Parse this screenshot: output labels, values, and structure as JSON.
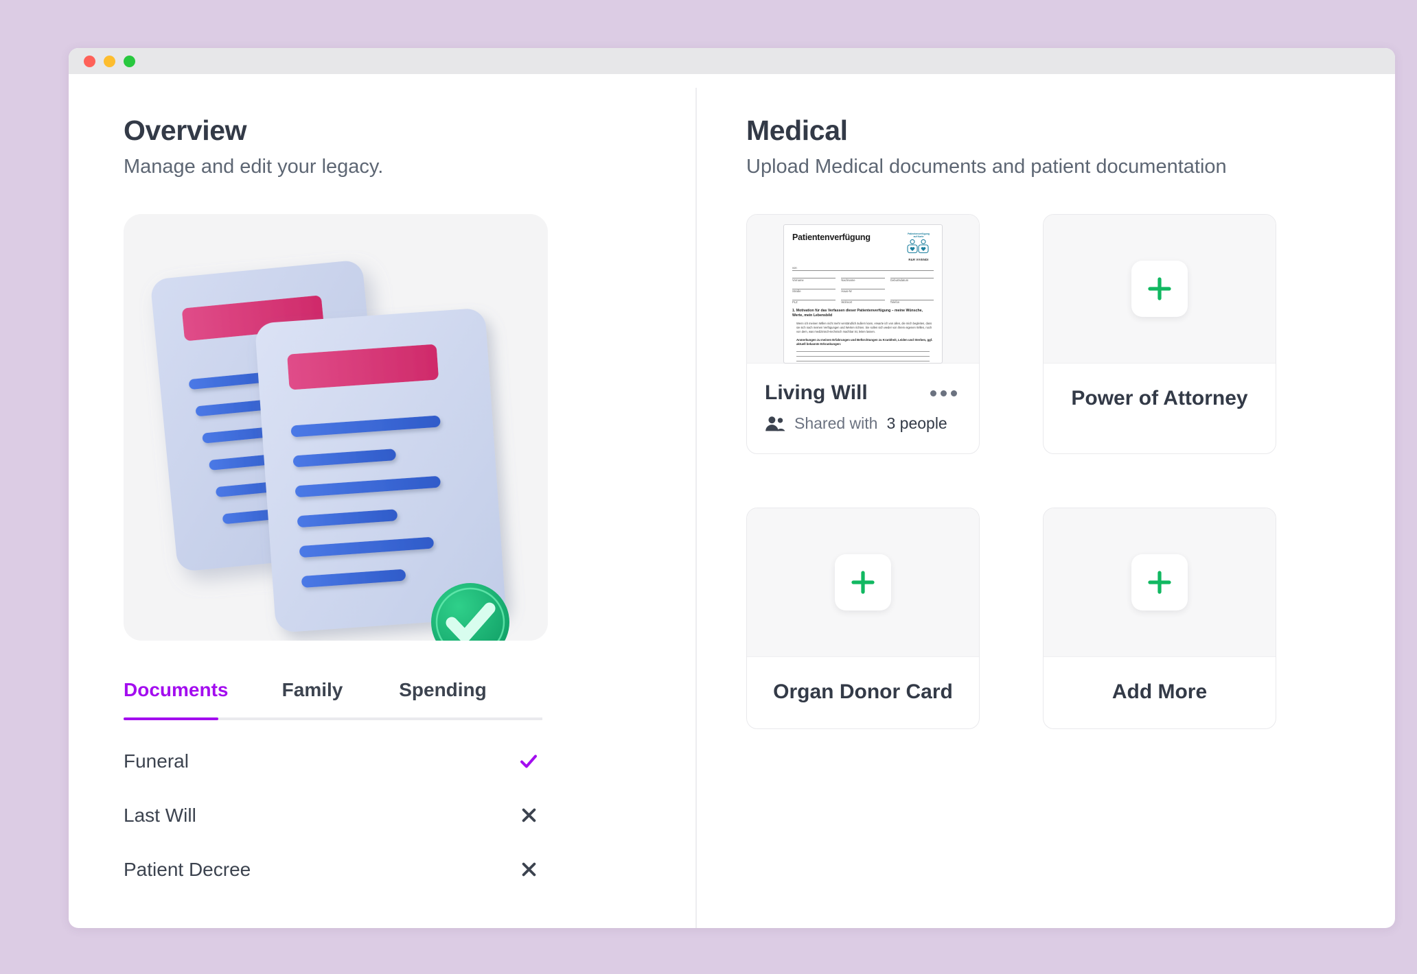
{
  "window": {
    "traffic_lights": [
      "close",
      "minimize",
      "maximize"
    ]
  },
  "left": {
    "title": "Overview",
    "subtitle": "Manage and edit your legacy.",
    "illustration": {
      "name": "documents-3d-illustration",
      "colors": {
        "paper": "#ccd6ee",
        "accent_bar": "#db3a77",
        "text_line": "#3d68d8",
        "check_badge": "#11a86a"
      }
    },
    "tabs": [
      {
        "label": "Documents",
        "active": true
      },
      {
        "label": "Family",
        "active": false
      },
      {
        "label": "Spending",
        "active": false
      }
    ],
    "documents": [
      {
        "label": "Funeral",
        "state": "check"
      },
      {
        "label": "Last Will",
        "state": "cross"
      },
      {
        "label": "Patient Decree",
        "state": "cross"
      }
    ]
  },
  "right": {
    "title": "Medical",
    "subtitle": "Upload Medical documents and patient documentation",
    "cards": [
      {
        "title": "Living Will",
        "type": "document",
        "shared_label": "Shared with",
        "shared_count": "3 people",
        "menu": "more-options"
      },
      {
        "title": "Power of Attorney",
        "type": "add",
        "add_label": "+"
      },
      {
        "title": "Organ Donor Card",
        "type": "add",
        "add_label": "+"
      },
      {
        "title": "Add More",
        "type": "add",
        "add_label": "+"
      }
    ]
  },
  "preview_document": {
    "title": "Patientenverfügung",
    "logo_caption_line1": "Patientenverfügung",
    "logo_caption_line2": "auf Karte",
    "logo_name": "R&R VIVENDI",
    "label_von": "von",
    "fields_row1": [
      "Vorname",
      "Nachname",
      "Geburtsdatum"
    ],
    "fields_row2": [
      "Straße",
      "Haus-Nr"
    ],
    "fields_row3": [
      "PLZ",
      "Wohnort",
      "Telefon"
    ],
    "section_heading": "1. Motivation für das Verfassen dieser Patientenverfügung – meine Wünsche, Werte, mein Lebensbild",
    "body_text": "Wenn ich meinen Willen nicht mehr verständlich äußern kann, erwarte ich von allen, die mich begleiten, dass sie sich nach meinen Verfügungen und Werten richten. Sie sollen sich weder von ihrem eigenen Willen, noch von dem, was medizinisch-technisch machbar ist, leiten lassen.",
    "note_text": "Anmerkungen zu meinen Erfahrungen und Befürchtungen zu Krankheit, Leiden und Sterben, ggf. aktuell bekannte Erkrankungen:"
  },
  "theme": {
    "background": "#dccce4",
    "accent_purple": "#a30def",
    "accent_green": "#11b861",
    "text_dark": "#333a47",
    "text_muted": "#5d6673"
  }
}
